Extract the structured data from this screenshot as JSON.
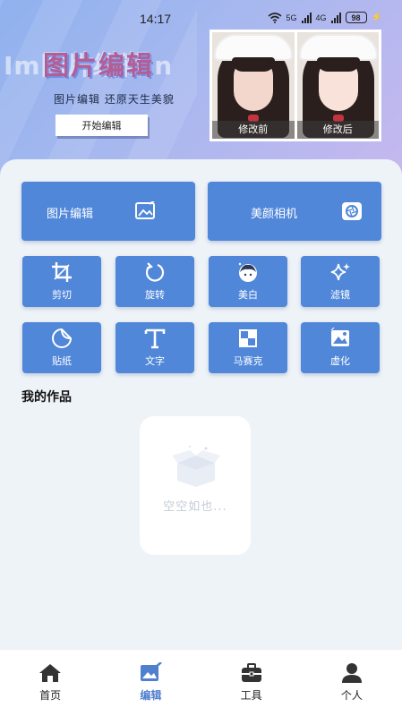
{
  "status_bar": {
    "time": "14:17",
    "wifi": "6",
    "network1": "5G",
    "network2": "4G",
    "battery": "98"
  },
  "hero": {
    "bg_text": "Im图片编辑in",
    "title": "图片编辑",
    "subtitle": "图片编辑  还原天生美貌",
    "start_button": "开始编辑",
    "before_label": "修改前",
    "after_label": "修改后"
  },
  "feature_cards": [
    {
      "label": "图片编辑",
      "icon": "image-edit-icon"
    },
    {
      "label": "美颜相机",
      "icon": "camera-aperture-icon"
    }
  ],
  "tools": [
    {
      "label": "剪切",
      "icon": "crop-icon"
    },
    {
      "label": "旋转",
      "icon": "rotate-icon"
    },
    {
      "label": "美白",
      "icon": "face-whitening-icon"
    },
    {
      "label": "滤镜",
      "icon": "sparkle-filter-icon"
    },
    {
      "label": "贴纸",
      "icon": "sticker-icon"
    },
    {
      "label": "文字",
      "icon": "text-icon"
    },
    {
      "label": "马赛克",
      "icon": "mosaic-icon"
    },
    {
      "label": "虚化",
      "icon": "blur-icon"
    }
  ],
  "works": {
    "title": "我的作品",
    "empty_text": "空空如也..."
  },
  "bottom_nav": [
    {
      "label": "首页",
      "icon": "home-icon",
      "active": false
    },
    {
      "label": "编辑",
      "icon": "edit-image-icon",
      "active": true
    },
    {
      "label": "工具",
      "icon": "toolbox-icon",
      "active": false
    },
    {
      "label": "个人",
      "icon": "person-icon",
      "active": false
    }
  ],
  "colors": {
    "accent": "#5087d9",
    "nav_active": "#4f7fcf",
    "background": "#eef3f8"
  }
}
